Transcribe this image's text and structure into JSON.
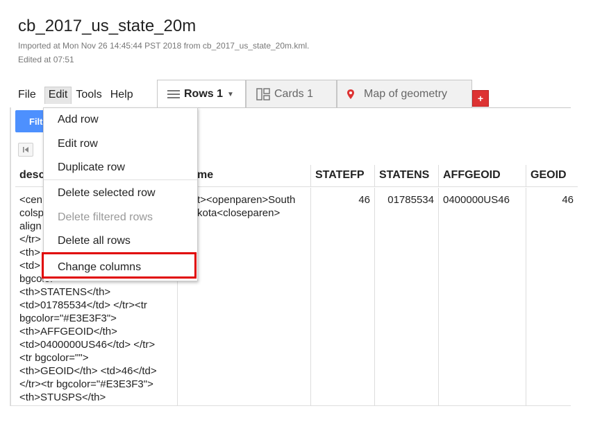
{
  "header": {
    "title": "cb_2017_us_state_20m",
    "imported": "Imported at Mon Nov 26 14:45:44 PST 2018 from cb_2017_us_state_20m.kml.",
    "edited": "Edited at 07:51"
  },
  "menubar": {
    "file": "File",
    "edit": "Edit",
    "tools": "Tools",
    "help": "Help"
  },
  "tabs": {
    "rows": "Rows 1",
    "cards": "Cards 1",
    "map": "Map of geometry",
    "add": "+"
  },
  "toolbar": {
    "filter_label": "Filt"
  },
  "edit_menu": {
    "items": [
      "Add row",
      "Edit row",
      "Duplicate row",
      "Delete selected row",
      "Delete filtered rows",
      "Delete all rows",
      "Change columns"
    ]
  },
  "table": {
    "columns": {
      "description": "desc",
      "name": "me",
      "statefp": "STATEFP",
      "statens": "STATENS",
      "affgeoid": "AFFGEOID",
      "geoid": "GEOID"
    },
    "row": {
      "description_lines": [
        "<cen",
        "colsp",
        "align",
        "</tr>",
        "<th>",
        "<td>",
        "bgcolor=\"\">",
        "<th>STATENS</th>",
        "<td>01785534</td> </tr><tr",
        "bgcolor=\"#E3E3F3\">",
        "<th>AFFGEOID</th>",
        "<td>0400000US46</td> </tr>",
        "<tr bgcolor=\"\">",
        "<th>GEOID</th> <td>46</td>",
        "</tr><tr bgcolor=\"#E3E3F3\">",
        "<th>STUSPS</th>"
      ],
      "name_line1": "t><openparen>South",
      "name_line2": "kota<closeparen>",
      "statefp": "46",
      "statens": "01785534",
      "affgeoid": "0400000US46",
      "geoid": "46"
    }
  },
  "colors": {
    "accent": "#4d90fe",
    "highlight": "#e00000",
    "add_tab": "#dd3333"
  },
  "icons": {
    "rows_tab": "list-icon",
    "rows_dropdown": "caret-down-icon",
    "cards_tab": "cards-icon",
    "map_tab": "map-pin-icon",
    "nav_first": "first-page-icon"
  }
}
